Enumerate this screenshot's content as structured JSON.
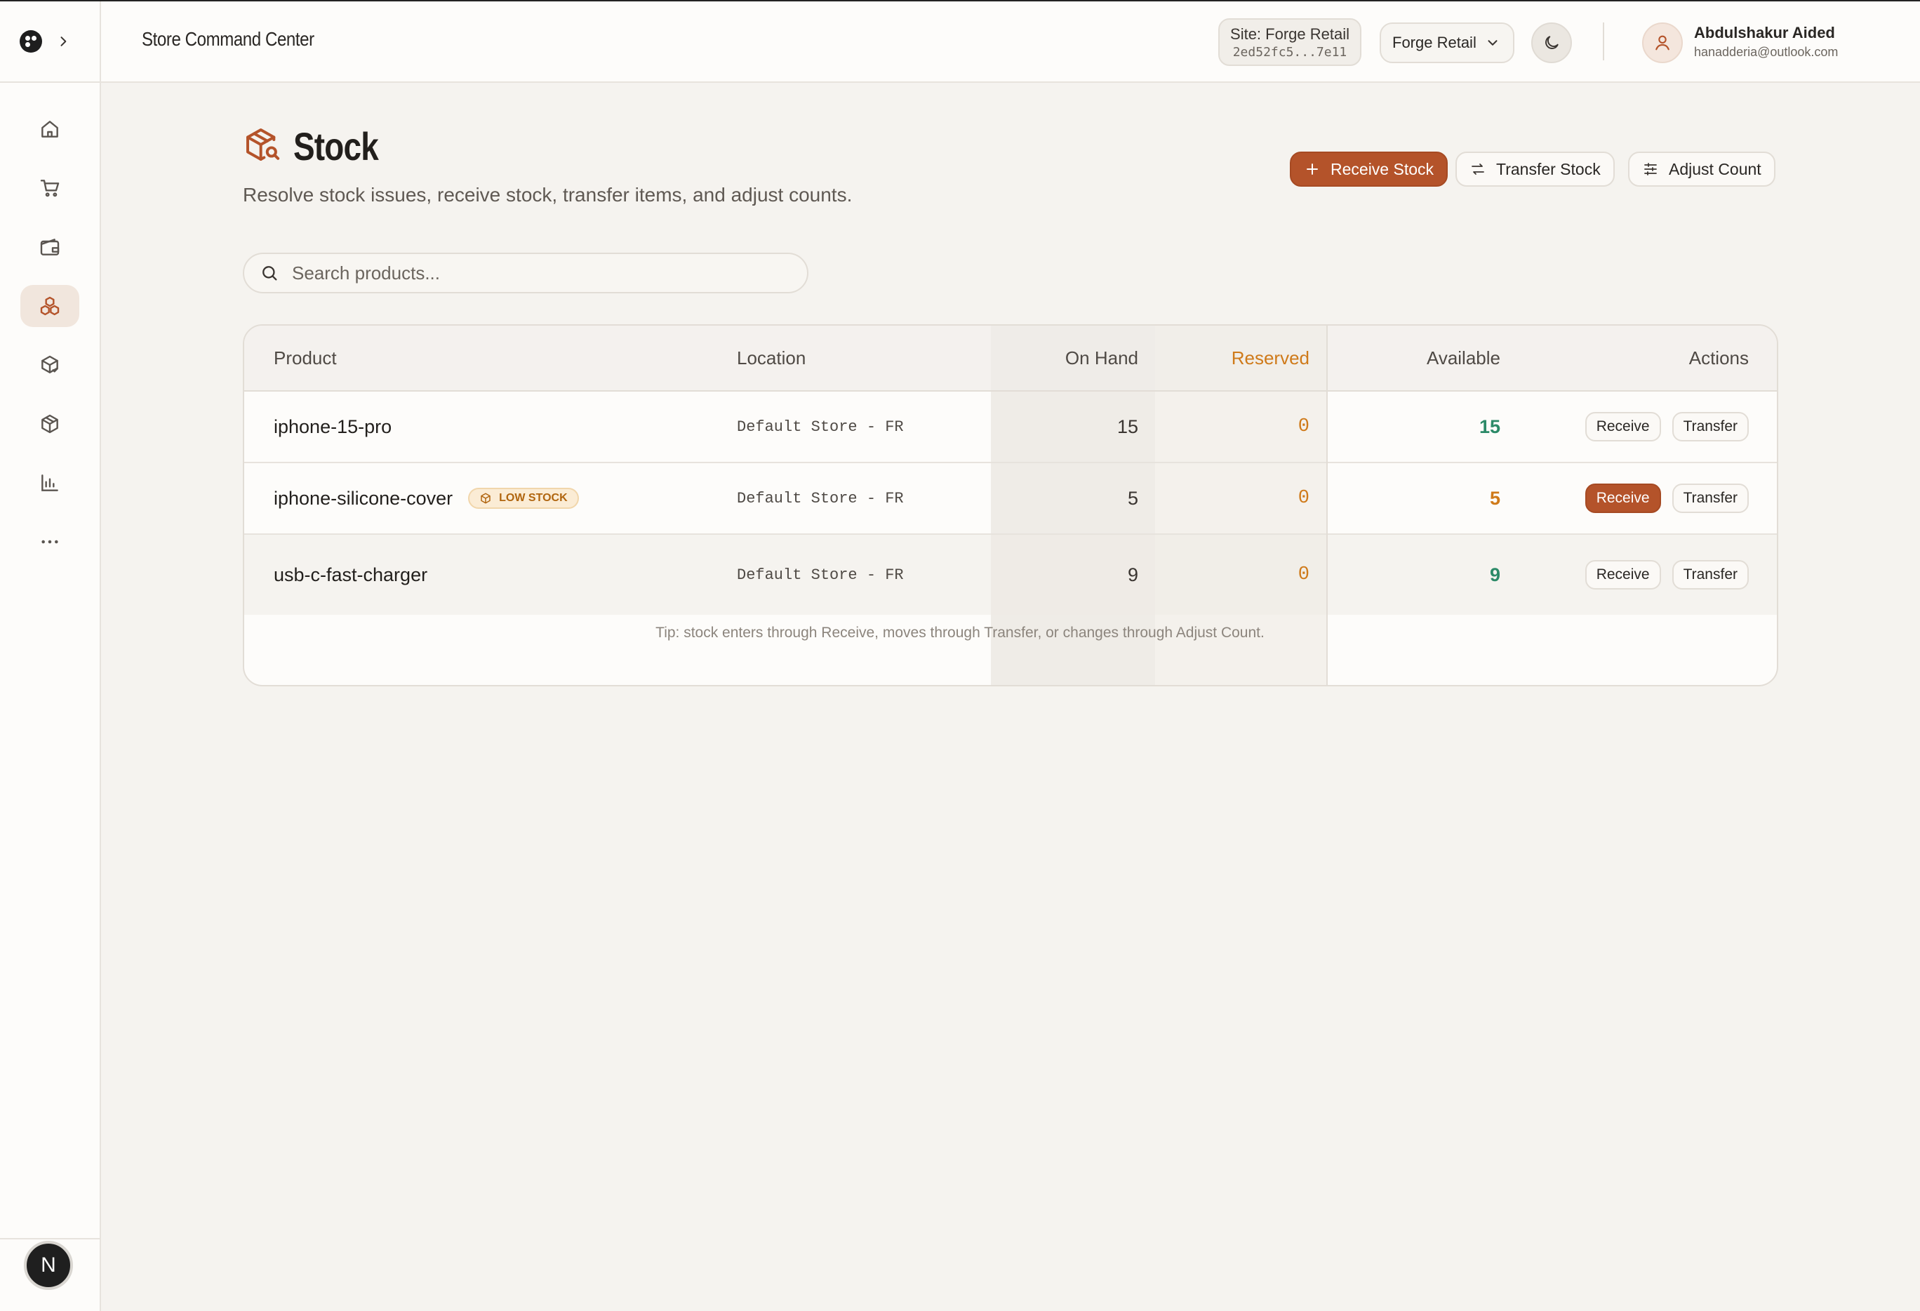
{
  "app": {
    "title": "Store Command Center"
  },
  "topbar": {
    "site_label": "Site: Forge Retail",
    "site_id": "2ed52fc5...7e11",
    "tenant_select_value": "Forge Retail",
    "user_name": "Abdulshakur Aided",
    "user_email": "hanadderia@outlook.com"
  },
  "sidebar": {
    "items": [
      {
        "name": "home",
        "icon": "home-icon",
        "active": false
      },
      {
        "name": "orders",
        "icon": "cart-icon",
        "active": false
      },
      {
        "name": "wallet",
        "icon": "wallet-icon",
        "active": false
      },
      {
        "name": "stock",
        "icon": "boxes-icon",
        "active": true
      },
      {
        "name": "packages",
        "icon": "package-check-icon",
        "active": false
      },
      {
        "name": "products",
        "icon": "box-icon",
        "active": false
      },
      {
        "name": "reports",
        "icon": "bar-chart-icon",
        "active": false
      },
      {
        "name": "more",
        "icon": "more-horizontal-icon",
        "active": false
      }
    ],
    "avatar_letter": "N"
  },
  "page": {
    "title": "Stock",
    "subtitle": "Resolve stock issues, receive stock, transfer items, and adjust counts.",
    "actions": {
      "receive": "Receive Stock",
      "transfer": "Transfer Stock",
      "adjust": "Adjust Count"
    },
    "search_placeholder": "Search products...",
    "tip": "Tip: stock enters through Receive, moves through Transfer, or changes through Adjust Count."
  },
  "table": {
    "headers": {
      "product": "Product",
      "location": "Location",
      "on_hand": "On Hand",
      "reserved": "Reserved",
      "available": "Available",
      "actions": "Actions"
    },
    "rows": [
      {
        "product": "iphone-15-pro",
        "location": "Default Store - FR",
        "on_hand": "15",
        "reserved": "0",
        "available": "15",
        "low_stock": false,
        "receive_label": "Receive",
        "transfer_label": "Transfer"
      },
      {
        "product": "iphone-silicone-cover",
        "location": "Default Store - FR",
        "on_hand": "5",
        "reserved": "0",
        "available": "5",
        "low_stock": true,
        "badge": "LOW STOCK",
        "receive_label": "Receive",
        "transfer_label": "Transfer"
      },
      {
        "product": "usb-c-fast-charger",
        "location": "Default Store - FR",
        "on_hand": "9",
        "reserved": "0",
        "available": "9",
        "low_stock": false,
        "receive_label": "Receive",
        "transfer_label": "Transfer"
      }
    ]
  },
  "colors": {
    "accent": "#b4532a",
    "reserved": "#cf7a1a",
    "available_ok": "#2c8a68",
    "background": "#f5f3ef"
  }
}
